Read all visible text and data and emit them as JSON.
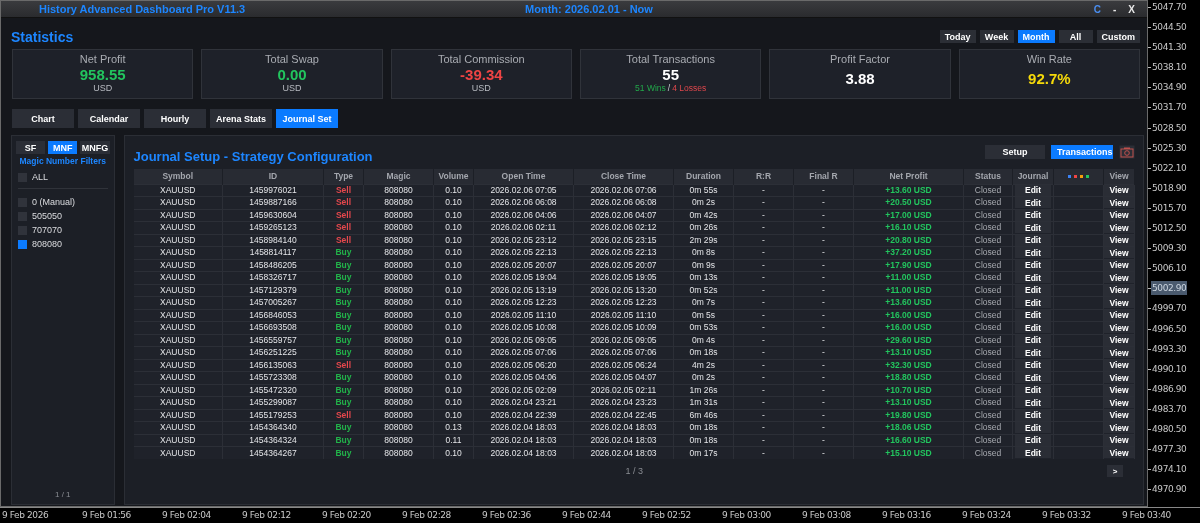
{
  "window": {
    "title": "History Advanced Dashboard Pro V11.3",
    "period": "Month: 2026.02.01 - Now",
    "controls": [
      "C",
      "-",
      "X"
    ]
  },
  "statistics": {
    "title": "Statistics",
    "periods": [
      {
        "label": "Today",
        "selected": false
      },
      {
        "label": "Week",
        "selected": false
      },
      {
        "label": "Month",
        "selected": true
      },
      {
        "label": "All",
        "selected": false
      },
      {
        "label": "Custom",
        "selected": false
      }
    ],
    "cards": [
      {
        "label": "Net Profit",
        "value": "958.55",
        "unit": "USD",
        "kind": "positive"
      },
      {
        "label": "Total Swap",
        "value": "0.00",
        "unit": "USD",
        "kind": "positive"
      },
      {
        "label": "Total Commission",
        "value": "-39.34",
        "unit": "USD",
        "kind": "negative"
      },
      {
        "label": "Total Transactions",
        "value": "55",
        "kind": "neutral",
        "breakdown": [
          {
            "text": "51 Wins",
            "kind": "positive"
          },
          {
            "text": "/",
            "kind": "neutral"
          },
          {
            "text": "4 Losses",
            "kind": "negative"
          }
        ]
      },
      {
        "label": "Profit Factor",
        "value": "3.88",
        "kind": "neutral"
      },
      {
        "label": "Win Rate",
        "value": "92.7%",
        "kind": "highlight"
      }
    ]
  },
  "tabs": [
    {
      "label": "Chart",
      "selected": false
    },
    {
      "label": "Calendar",
      "selected": false
    },
    {
      "label": "Hourly",
      "selected": false
    },
    {
      "label": "Arena Stats",
      "selected": false
    },
    {
      "label": "Journal Set",
      "selected": true
    }
  ],
  "sidebar": {
    "filter_tabs": [
      {
        "label": "SF",
        "selected": false
      },
      {
        "label": "MNF",
        "selected": true
      },
      {
        "label": "MNFG",
        "selected": false
      }
    ],
    "title": "Magic Number Filters",
    "all": {
      "label": "ALL",
      "checked": false
    },
    "items": [
      {
        "label": "0 (Manual)",
        "checked": false
      },
      {
        "label": "505050",
        "checked": false
      },
      {
        "label": "707070",
        "checked": false
      },
      {
        "label": "808080",
        "checked": true
      }
    ],
    "page": "1 / 1"
  },
  "journal": {
    "title": "Journal Setup - Strategy Configuration",
    "buttons": [
      {
        "label": "Setup",
        "selected": false
      },
      {
        "label": "Transactions",
        "selected": true
      }
    ],
    "columns": [
      {
        "label": "Symbol"
      },
      {
        "label": "ID"
      },
      {
        "label": "Type"
      },
      {
        "label": "Magic"
      },
      {
        "label": "Volume"
      },
      {
        "label": "Open Time"
      },
      {
        "label": "Close Time"
      },
      {
        "label": "Duration"
      },
      {
        "label": "R:R"
      },
      {
        "label": "Final R"
      },
      {
        "label": "Net Profit"
      },
      {
        "label": "Status"
      },
      {
        "label": "Journal"
      },
      {
        "kind": "dots"
      },
      {
        "label": "View"
      }
    ],
    "rows": [
      {
        "symbol": "XAUUSD",
        "id": "1459976021",
        "type": "Sell",
        "kind": "sell",
        "magic": "808080",
        "volume": "0.10",
        "open_time": "2026.02.06 07:05",
        "close_time": "2026.02.06 07:06",
        "duration": "0m 55s",
        "rr": "-",
        "final_r": "-",
        "net_profit": "+13.60 USD",
        "status": "Closed",
        "journal": "Edit",
        "view": "View"
      },
      {
        "symbol": "XAUUSD",
        "id": "1459887166",
        "type": "Sell",
        "kind": "sell",
        "magic": "808080",
        "volume": "0.10",
        "open_time": "2026.02.06 06:08",
        "close_time": "2026.02.06 06:08",
        "duration": "0m 2s",
        "rr": "-",
        "final_r": "-",
        "net_profit": "+20.50 USD",
        "status": "Closed",
        "journal": "Edit",
        "view": "View"
      },
      {
        "symbol": "XAUUSD",
        "id": "1459630604",
        "type": "Sell",
        "kind": "sell",
        "magic": "808080",
        "volume": "0.10",
        "open_time": "2026.02.06 04:06",
        "close_time": "2026.02.06 04:07",
        "duration": "0m 42s",
        "rr": "-",
        "final_r": "-",
        "net_profit": "+17.00 USD",
        "status": "Closed",
        "journal": "Edit",
        "view": "View"
      },
      {
        "symbol": "XAUUSD",
        "id": "1459265123",
        "type": "Sell",
        "kind": "sell",
        "magic": "808080",
        "volume": "0.10",
        "open_time": "2026.02.06 02:11",
        "close_time": "2026.02.06 02:12",
        "duration": "0m 26s",
        "rr": "-",
        "final_r": "-",
        "net_profit": "+16.10 USD",
        "status": "Closed",
        "journal": "Edit",
        "view": "View"
      },
      {
        "symbol": "XAUUSD",
        "id": "1458984140",
        "type": "Sell",
        "kind": "sell",
        "magic": "808080",
        "volume": "0.10",
        "open_time": "2026.02.05 23:12",
        "close_time": "2026.02.05 23:15",
        "duration": "2m 29s",
        "rr": "-",
        "final_r": "-",
        "net_profit": "+20.80 USD",
        "status": "Closed",
        "journal": "Edit",
        "view": "View"
      },
      {
        "symbol": "XAUUSD",
        "id": "1458814117",
        "type": "Buy",
        "kind": "buy",
        "magic": "808080",
        "volume": "0.10",
        "open_time": "2026.02.05 22:13",
        "close_time": "2026.02.05 22:13",
        "duration": "0m 8s",
        "rr": "-",
        "final_r": "-",
        "net_profit": "+37.20 USD",
        "status": "Closed",
        "journal": "Edit",
        "view": "View"
      },
      {
        "symbol": "XAUUSD",
        "id": "1458486205",
        "type": "Buy",
        "kind": "buy",
        "magic": "808080",
        "volume": "0.10",
        "open_time": "2026.02.05 20:07",
        "close_time": "2026.02.05 20:07",
        "duration": "0m 9s",
        "rr": "-",
        "final_r": "-",
        "net_profit": "+17.90 USD",
        "status": "Closed",
        "journal": "Edit",
        "view": "View"
      },
      {
        "symbol": "XAUUSD",
        "id": "1458326717",
        "type": "Buy",
        "kind": "buy",
        "magic": "808080",
        "volume": "0.10",
        "open_time": "2026.02.05 19:04",
        "close_time": "2026.02.05 19:05",
        "duration": "0m 13s",
        "rr": "-",
        "final_r": "-",
        "net_profit": "+11.00 USD",
        "status": "Closed",
        "journal": "Edit",
        "view": "View"
      },
      {
        "symbol": "XAUUSD",
        "id": "1457129379",
        "type": "Buy",
        "kind": "buy",
        "magic": "808080",
        "volume": "0.10",
        "open_time": "2026.02.05 13:19",
        "close_time": "2026.02.05 13:20",
        "duration": "0m 52s",
        "rr": "-",
        "final_r": "-",
        "net_profit": "+11.00 USD",
        "status": "Closed",
        "journal": "Edit",
        "view": "View"
      },
      {
        "symbol": "XAUUSD",
        "id": "1457005267",
        "type": "Buy",
        "kind": "buy",
        "magic": "808080",
        "volume": "0.10",
        "open_time": "2026.02.05 12:23",
        "close_time": "2026.02.05 12:23",
        "duration": "0m 7s",
        "rr": "-",
        "final_r": "-",
        "net_profit": "+13.60 USD",
        "status": "Closed",
        "journal": "Edit",
        "view": "View"
      },
      {
        "symbol": "XAUUSD",
        "id": "1456846053",
        "type": "Buy",
        "kind": "buy",
        "magic": "808080",
        "volume": "0.10",
        "open_time": "2026.02.05 11:10",
        "close_time": "2026.02.05 11:10",
        "duration": "0m 5s",
        "rr": "-",
        "final_r": "-",
        "net_profit": "+16.00 USD",
        "status": "Closed",
        "journal": "Edit",
        "view": "View"
      },
      {
        "symbol": "XAUUSD",
        "id": "1456693508",
        "type": "Buy",
        "kind": "buy",
        "magic": "808080",
        "volume": "0.10",
        "open_time": "2026.02.05 10:08",
        "close_time": "2026.02.05 10:09",
        "duration": "0m 53s",
        "rr": "-",
        "final_r": "-",
        "net_profit": "+16.00 USD",
        "status": "Closed",
        "journal": "Edit",
        "view": "View"
      },
      {
        "symbol": "XAUUSD",
        "id": "1456559757",
        "type": "Buy",
        "kind": "buy",
        "magic": "808080",
        "volume": "0.10",
        "open_time": "2026.02.05 09:05",
        "close_time": "2026.02.05 09:05",
        "duration": "0m 4s",
        "rr": "-",
        "final_r": "-",
        "net_profit": "+29.60 USD",
        "status": "Closed",
        "journal": "Edit",
        "view": "View"
      },
      {
        "symbol": "XAUUSD",
        "id": "1456251225",
        "type": "Buy",
        "kind": "buy",
        "magic": "808080",
        "volume": "0.10",
        "open_time": "2026.02.05 07:06",
        "close_time": "2026.02.05 07:06",
        "duration": "0m 18s",
        "rr": "-",
        "final_r": "-",
        "net_profit": "+13.10 USD",
        "status": "Closed",
        "journal": "Edit",
        "view": "View"
      },
      {
        "symbol": "XAUUSD",
        "id": "1456135063",
        "type": "Sell",
        "kind": "sell",
        "magic": "808080",
        "volume": "0.10",
        "open_time": "2026.02.05 06:20",
        "close_time": "2026.02.05 06:24",
        "duration": "4m 2s",
        "rr": "-",
        "final_r": "-",
        "net_profit": "+32.30 USD",
        "status": "Closed",
        "journal": "Edit",
        "view": "View"
      },
      {
        "symbol": "XAUUSD",
        "id": "1455723308",
        "type": "Buy",
        "kind": "buy",
        "magic": "808080",
        "volume": "0.10",
        "open_time": "2026.02.05 04:06",
        "close_time": "2026.02.05 04:07",
        "duration": "0m 2s",
        "rr": "-",
        "final_r": "-",
        "net_profit": "+18.80 USD",
        "status": "Closed",
        "journal": "Edit",
        "view": "View"
      },
      {
        "symbol": "XAUUSD",
        "id": "1455472320",
        "type": "Buy",
        "kind": "buy",
        "magic": "808080",
        "volume": "0.10",
        "open_time": "2026.02.05 02:09",
        "close_time": "2026.02.05 02:11",
        "duration": "1m 26s",
        "rr": "-",
        "final_r": "-",
        "net_profit": "+10.70 USD",
        "status": "Closed",
        "journal": "Edit",
        "view": "View"
      },
      {
        "symbol": "XAUUSD",
        "id": "1455299087",
        "type": "Buy",
        "kind": "buy",
        "magic": "808080",
        "volume": "0.10",
        "open_time": "2026.02.04 23:21",
        "close_time": "2026.02.04 23:23",
        "duration": "1m 31s",
        "rr": "-",
        "final_r": "-",
        "net_profit": "+13.10 USD",
        "status": "Closed",
        "journal": "Edit",
        "view": "View"
      },
      {
        "symbol": "XAUUSD",
        "id": "1455179253",
        "type": "Sell",
        "kind": "sell",
        "magic": "808080",
        "volume": "0.10",
        "open_time": "2026.02.04 22:39",
        "close_time": "2026.02.04 22:45",
        "duration": "6m 46s",
        "rr": "-",
        "final_r": "-",
        "net_profit": "+19.80 USD",
        "status": "Closed",
        "journal": "Edit",
        "view": "View"
      },
      {
        "symbol": "XAUUSD",
        "id": "1454364340",
        "type": "Buy",
        "kind": "buy",
        "magic": "808080",
        "volume": "0.13",
        "open_time": "2026.02.04 18:03",
        "close_time": "2026.02.04 18:03",
        "duration": "0m 18s",
        "rr": "-",
        "final_r": "-",
        "net_profit": "+18.06 USD",
        "status": "Closed",
        "journal": "Edit",
        "view": "View"
      },
      {
        "symbol": "XAUUSD",
        "id": "1454364324",
        "type": "Buy",
        "kind": "buy",
        "magic": "808080",
        "volume": "0.11",
        "open_time": "2026.02.04 18:03",
        "close_time": "2026.02.04 18:03",
        "duration": "0m 18s",
        "rr": "-",
        "final_r": "-",
        "net_profit": "+16.60 USD",
        "status": "Closed",
        "journal": "Edit",
        "view": "View"
      },
      {
        "symbol": "XAUUSD",
        "id": "1454364267",
        "type": "Buy",
        "kind": "buy",
        "magic": "808080",
        "volume": "0.10",
        "open_time": "2026.02.04 18:03",
        "close_time": "2026.02.04 18:03",
        "duration": "0m 17s",
        "rr": "-",
        "final_r": "-",
        "net_profit": "+15.10 USD",
        "status": "Closed",
        "journal": "Edit",
        "view": "View"
      }
    ],
    "page": "1 / 3",
    "next": ">"
  },
  "price_axis": [
    {
      "text": "5047.70",
      "current": false
    },
    {
      "text": "5044.50",
      "current": false
    },
    {
      "text": "5041.30",
      "current": false
    },
    {
      "text": "5038.10",
      "current": false
    },
    {
      "text": "5034.90",
      "current": false
    },
    {
      "text": "5031.70",
      "current": false
    },
    {
      "text": "5028.50",
      "current": false
    },
    {
      "text": "5025.30",
      "current": false
    },
    {
      "text": "5022.10",
      "current": false
    },
    {
      "text": "5018.90",
      "current": false
    },
    {
      "text": "5015.70",
      "current": false
    },
    {
      "text": "5012.50",
      "current": false
    },
    {
      "text": "5009.30",
      "current": false
    },
    {
      "text": "5006.10",
      "current": false
    },
    {
      "text": "5002.90",
      "current": true
    },
    {
      "text": "4999.70",
      "current": false
    },
    {
      "text": "4996.50",
      "current": false
    },
    {
      "text": "4993.30",
      "current": false
    },
    {
      "text": "4990.10",
      "current": false
    },
    {
      "text": "4986.90",
      "current": false
    },
    {
      "text": "4983.70",
      "current": false
    },
    {
      "text": "4980.50",
      "current": false
    },
    {
      "text": "4977.30",
      "current": false
    },
    {
      "text": "4974.10",
      "current": false
    },
    {
      "text": "4970.90",
      "current": false
    }
  ],
  "time_axis": [
    "9 Feb 2026",
    "9 Feb 01:56",
    "9 Feb 02:04",
    "9 Feb 02:12",
    "9 Feb 02:20",
    "9 Feb 02:28",
    "9 Feb 02:36",
    "9 Feb 02:44",
    "9 Feb 02:52",
    "9 Feb 03:00",
    "9 Feb 03:08",
    "9 Feb 03:16",
    "9 Feb 03:24",
    "9 Feb 03:32",
    "9 Feb 03:40"
  ]
}
